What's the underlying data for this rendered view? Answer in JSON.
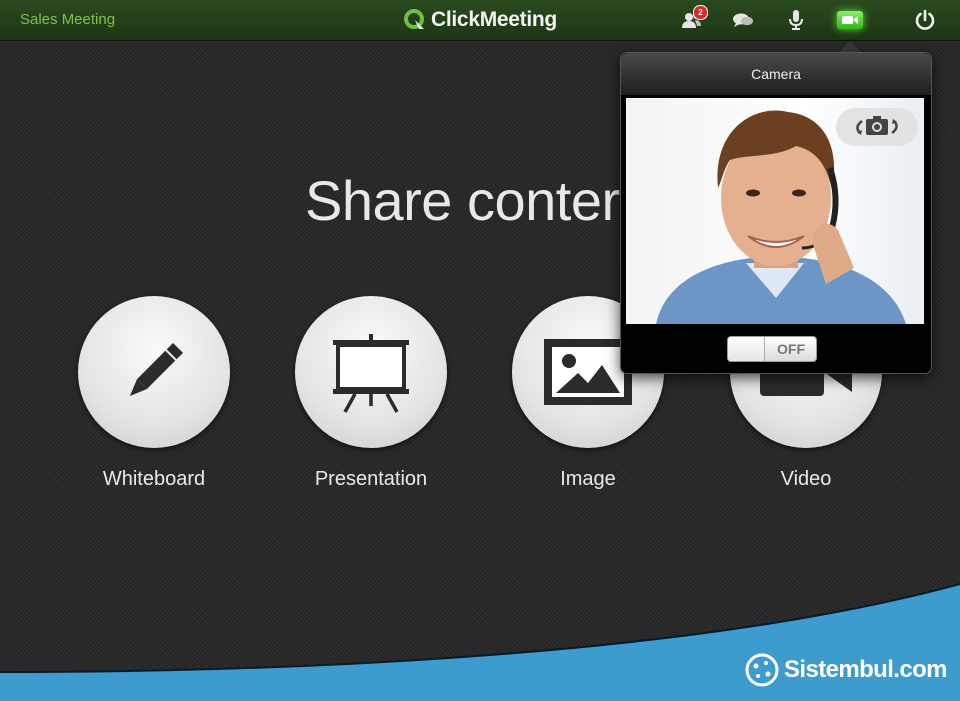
{
  "topbar": {
    "meeting_name": "Sales Meeting",
    "logo_text": "ClickMeeting",
    "attendees_badge": "2",
    "buttons": [
      "attendees-icon",
      "chat-icon",
      "microphone-icon",
      "camera-icon",
      "power-icon"
    ],
    "active_color": "#4fd82f"
  },
  "main": {
    "headline": "Share conter",
    "tiles": [
      {
        "label": "Whiteboard",
        "icon": "pencil-icon"
      },
      {
        "label": "Presentation",
        "icon": "easel-icon"
      },
      {
        "label": "Image",
        "icon": "image-icon"
      },
      {
        "label": "Video",
        "icon": "video-icon"
      }
    ]
  },
  "camera_popover": {
    "title": "Camera",
    "toggle_label": "OFF",
    "switch_icon": "switch-camera-icon"
  },
  "watermark": {
    "text": "Sistembul.com"
  },
  "colors": {
    "topbar": "#234118",
    "brand_green": "#7cc34a",
    "wave_blue": "#3d9ccd"
  }
}
